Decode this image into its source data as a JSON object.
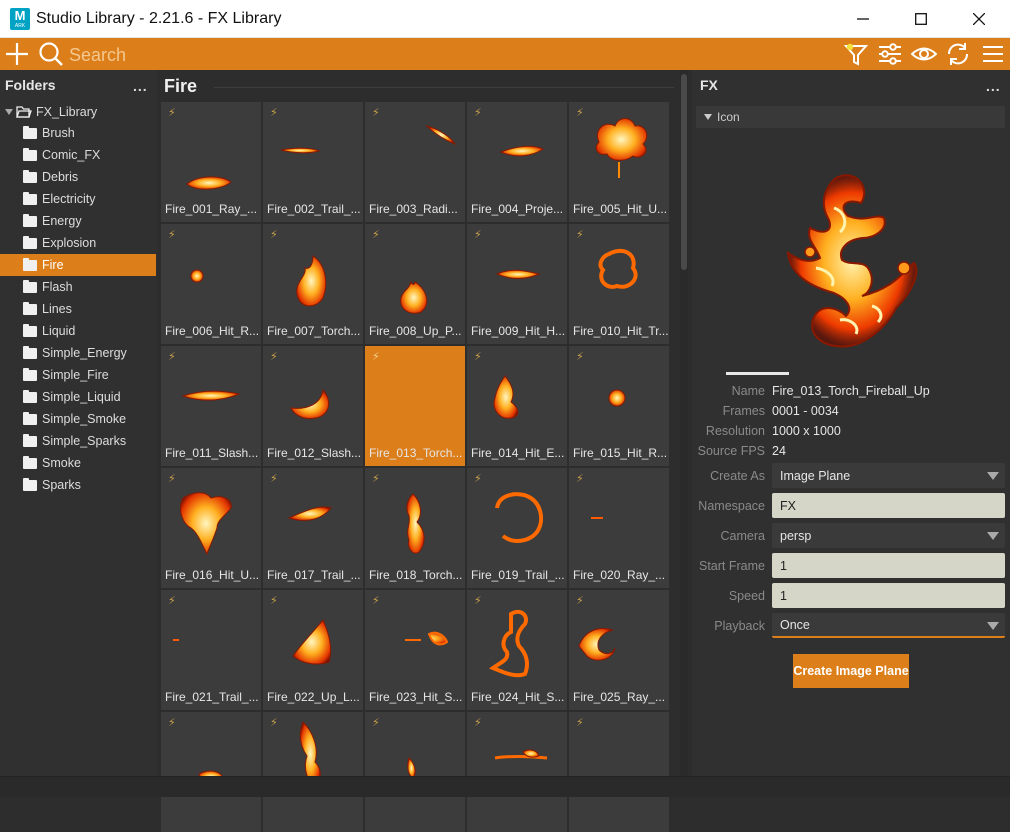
{
  "window": {
    "title": "Studio Library - 2.21.6 - FX Library",
    "app_icon_letter": "M",
    "app_icon_sub": "ARK"
  },
  "toolbar": {
    "search_placeholder": "Search",
    "accent": "#dc7f1a"
  },
  "folders": {
    "header": "Folders",
    "menu": "...",
    "root": "FX_Library",
    "items": [
      {
        "label": "Brush",
        "active": false
      },
      {
        "label": "Comic_FX",
        "active": false
      },
      {
        "label": "Debris",
        "active": false
      },
      {
        "label": "Electricity",
        "active": false
      },
      {
        "label": "Energy",
        "active": false
      },
      {
        "label": "Explosion",
        "active": false
      },
      {
        "label": "Fire",
        "active": true
      },
      {
        "label": "Flash",
        "active": false
      },
      {
        "label": "Lines",
        "active": false
      },
      {
        "label": "Liquid",
        "active": false
      },
      {
        "label": "Simple_Energy",
        "active": false
      },
      {
        "label": "Simple_Fire",
        "active": false
      },
      {
        "label": "Simple_Liquid",
        "active": false
      },
      {
        "label": "Simple_Smoke",
        "active": false
      },
      {
        "label": "Simple_Sparks",
        "active": false
      },
      {
        "label": "Smoke",
        "active": false
      },
      {
        "label": "Sparks",
        "active": false
      }
    ]
  },
  "grid": {
    "title": "Fire",
    "items": [
      {
        "label": "Fire_001_Ray_...",
        "thumb": "ray"
      },
      {
        "label": "Fire_002_Trail_...",
        "thumb": "streak"
      },
      {
        "label": "Fire_003_Radi...",
        "thumb": "arc"
      },
      {
        "label": "Fire_004_Proje...",
        "thumb": "streak2"
      },
      {
        "label": "Fire_005_Hit_U...",
        "thumb": "burst"
      },
      {
        "label": "Fire_006_Hit_R...",
        "thumb": "dot"
      },
      {
        "label": "Fire_007_Torch...",
        "thumb": "torch"
      },
      {
        "label": "Fire_008_Up_P...",
        "thumb": "flame"
      },
      {
        "label": "Fire_009_Hit_H...",
        "thumb": "streak3"
      },
      {
        "label": "Fire_010_Hit_Tr...",
        "thumb": "ring"
      },
      {
        "label": "Fire_011_Slash...",
        "thumb": "slash"
      },
      {
        "label": "Fire_012_Slash...",
        "thumb": "slash2"
      },
      {
        "label": "Fire_013_Torch...",
        "thumb": "none",
        "selected": true
      },
      {
        "label": "Fire_014_Hit_E...",
        "thumb": "blob"
      },
      {
        "label": "Fire_015_Hit_R...",
        "thumb": "dot2"
      },
      {
        "label": "Fire_016_Hit_U...",
        "thumb": "burst2"
      },
      {
        "label": "Fire_017_Trail_...",
        "thumb": "trail"
      },
      {
        "label": "Fire_018_Torch...",
        "thumb": "torch2"
      },
      {
        "label": "Fire_019_Trail_...",
        "thumb": "circle"
      },
      {
        "label": "Fire_020_Ray_...",
        "thumb": "tiny"
      },
      {
        "label": "Fire_021_Trail_...",
        "thumb": "tiny2"
      },
      {
        "label": "Fire_022_Up_L...",
        "thumb": "up"
      },
      {
        "label": "Fire_023_Hit_S...",
        "thumb": "sparks"
      },
      {
        "label": "Fire_024_Hit_S...",
        "thumb": "scatter"
      },
      {
        "label": "Fire_025_Ray_...",
        "thumb": "crescent"
      },
      {
        "label": "",
        "thumb": "bottom1"
      },
      {
        "label": "",
        "thumb": "bottom2"
      },
      {
        "label": "",
        "thumb": "bottom3"
      },
      {
        "label": "",
        "thumb": "bottom4"
      },
      {
        "label": "",
        "thumb": "none"
      }
    ]
  },
  "details": {
    "header": "FX",
    "menu": "...",
    "section": "Icon",
    "preview_progress": 0.03,
    "props": [
      {
        "label": "Name",
        "value": "Fire_013_Torch_Fireball_Up"
      },
      {
        "label": "Frames",
        "value": "0001 - 0034"
      },
      {
        "label": "Resolution",
        "value": "1000 x 1000"
      },
      {
        "label": "Source FPS",
        "value": "24"
      }
    ],
    "options": [
      {
        "label": "Create As",
        "value": "Image Plane",
        "kind": "dropdown"
      },
      {
        "label": "Namespace",
        "value": "FX",
        "kind": "text"
      },
      {
        "label": "Camera",
        "value": "persp",
        "kind": "dropdown"
      },
      {
        "label": "Start Frame",
        "value": "1",
        "kind": "text"
      },
      {
        "label": "Speed",
        "value": "1",
        "kind": "text"
      },
      {
        "label": "Playback",
        "value": "Once",
        "kind": "dropdown-focus"
      }
    ],
    "create_button": "Create Image Plane"
  }
}
